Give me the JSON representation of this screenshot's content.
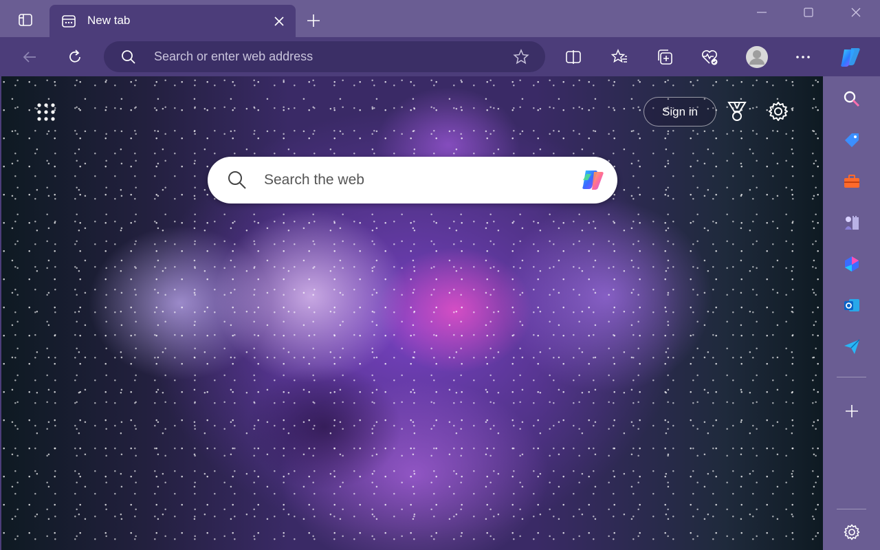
{
  "titlebar": {
    "tab_title": "New tab"
  },
  "toolbar": {
    "address_placeholder": "Search or enter web address"
  },
  "newtab": {
    "signin_label": "Sign in",
    "search_placeholder": "Search the web"
  },
  "colors": {
    "titlebar_bg": "#6a5d93",
    "toolbar_bg": "#4c3d7a",
    "addressbar_bg": "#3b2f66",
    "sidebar_bg": "#6a5d93"
  },
  "icons": {
    "tab_actions": "tab-actions-icon",
    "tab_favicon": "newtab-page-icon",
    "tab_close": "close-icon",
    "new_tab": "plus-icon",
    "minimize": "minimize-icon",
    "maximize": "maximize-icon",
    "close_window": "close-icon",
    "back": "back-arrow-icon",
    "refresh": "refresh-icon",
    "address_search": "search-icon",
    "favorite": "star-icon",
    "split_screen": "split-screen-icon",
    "favorites": "favorites-icon",
    "collections": "collections-icon",
    "browser_essentials": "heart-pulse-icon",
    "profile": "profile-avatar-icon",
    "more": "ellipsis-icon",
    "copilot": "copilot-icon",
    "apps": "app-launcher-icon",
    "rewards": "rewards-medal-icon",
    "page_settings": "gear-icon",
    "sidebar_search": "search-icon",
    "sidebar_shopping": "tag-icon",
    "sidebar_tools": "toolbox-icon",
    "sidebar_games": "chess-icon",
    "sidebar_m365": "microsoft-365-icon",
    "sidebar_outlook": "outlook-icon",
    "sidebar_drop": "send-icon",
    "sidebar_add": "plus-icon",
    "sidebar_settings": "gear-icon"
  }
}
